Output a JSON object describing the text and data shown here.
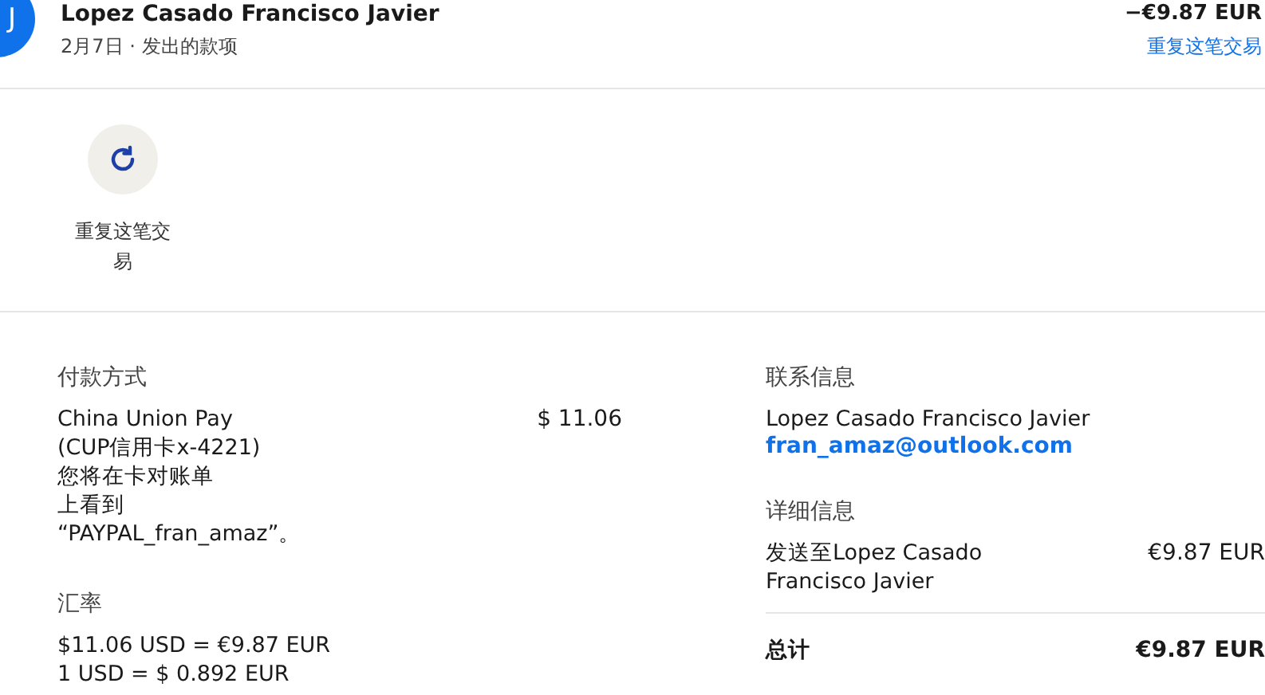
{
  "header": {
    "avatar": "J",
    "name": "Lopez Casado Francisco Javier",
    "date": "2月7日",
    "separator": "·",
    "type": "发出的款项",
    "amount": "−€9.87 EUR",
    "repeat_link": "重复这笔交易"
  },
  "actions": [
    {
      "label": "重复这笔交易"
    }
  ],
  "payment": {
    "heading": "付款方式",
    "method_lines": [
      "China Union Pay",
      "(CUP信用卡x-4221)",
      "您将在卡对账单",
      "上看到",
      "“PAYPAL_fran_amaz”。"
    ],
    "amount": "$ 11.06"
  },
  "exchange": {
    "heading": "汇率",
    "lines": [
      "$11.06 USD = €9.87 EUR",
      "1 USD = $ 0.892 EUR"
    ]
  },
  "contact": {
    "heading": "联系信息",
    "name": "Lopez Casado Francisco Javier",
    "email": "fran_amaz@outlook.com"
  },
  "details": {
    "heading": "详细信息",
    "rows": [
      {
        "kind": "item",
        "label": "发送至Lopez Casado\nFrancisco Javier",
        "value": "€9.87 EUR"
      },
      {
        "kind": "total",
        "label": "总计",
        "value": "€9.87 EUR"
      }
    ]
  }
}
